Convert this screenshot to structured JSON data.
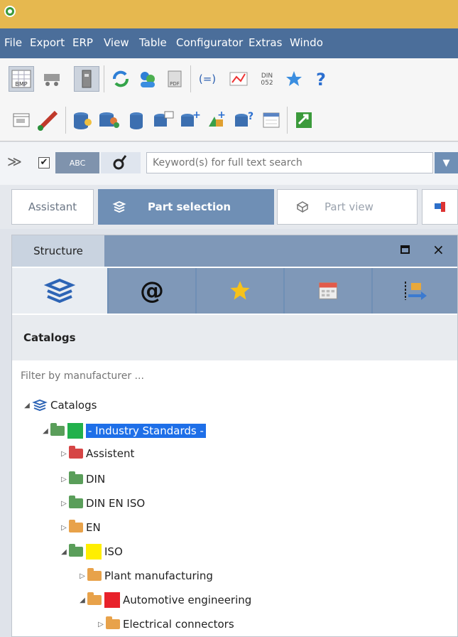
{
  "menu": {
    "file": "File",
    "export": "Export",
    "erp": "ERP",
    "view": "View",
    "table": "Table",
    "configurator": "Configurator",
    "extras": "Extras",
    "window": "Windo"
  },
  "toolbar": {
    "bmp_label": "BMP",
    "pdf_label": "PDF",
    "din_label": "DIN",
    "din_sub": "052",
    "eq_label": "(=)"
  },
  "search": {
    "abc_label": "ABC",
    "placeholder": "Keyword(s) for full text search"
  },
  "tabs": {
    "assistant": "Assistant",
    "part_selection": "Part selection",
    "part_view": "Part view"
  },
  "panel": {
    "structure_tab": "Structure",
    "catalogs_heading": "Catalogs",
    "filter_placeholder": "Filter by manufacturer ..."
  },
  "tree": [
    {
      "label": "Catalogs"
    },
    {
      "label": "- Industry Standards -",
      "swatch": "#22b14c",
      "selected": true
    },
    {
      "label": "Assistent"
    },
    {
      "label": "DIN"
    },
    {
      "label": "DIN EN ISO"
    },
    {
      "label": "EN"
    },
    {
      "label": "ISO",
      "swatch": "#ffee00"
    },
    {
      "label": "Plant manufacturing"
    },
    {
      "label": "Automotive engineering",
      "swatch": "#e8212a"
    },
    {
      "label": "Electrical connectors"
    }
  ],
  "colors": {
    "titlebar": "#e6b84f",
    "menubar": "#4b6e9a",
    "active_tab": "#6f8fb5",
    "selection": "#1e6fe8",
    "green_folder": "#5a9e5a",
    "orange_folder": "#e8a24a",
    "red_folder": "#d64545"
  }
}
